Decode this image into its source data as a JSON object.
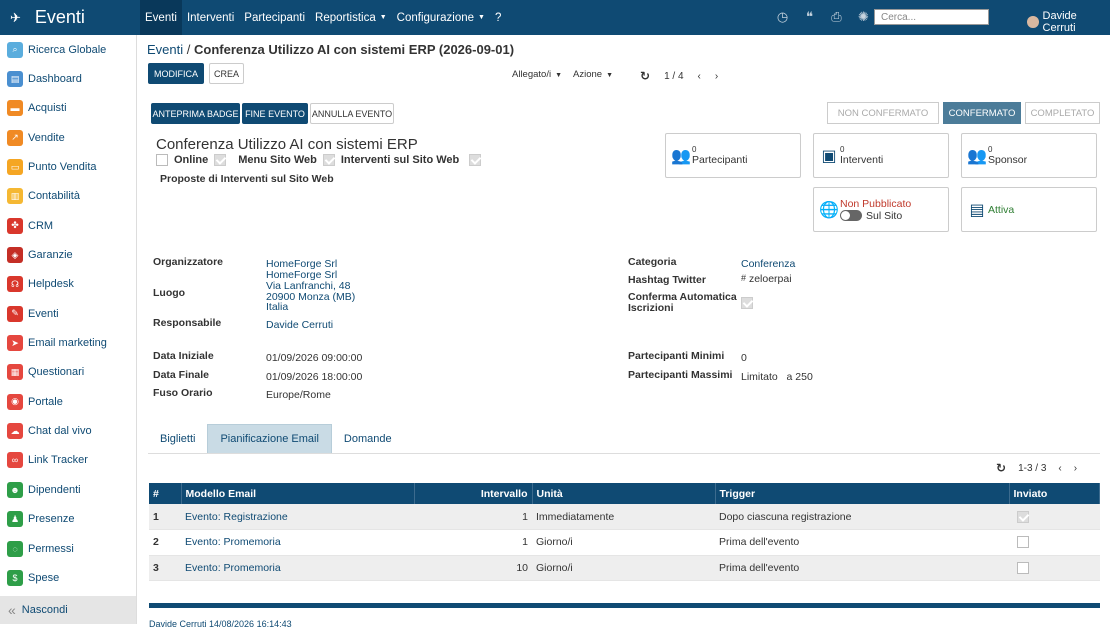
{
  "app": {
    "title": "Eventi"
  },
  "menu": {
    "items": [
      "Eventi",
      "Interventi",
      "Partecipanti",
      "Reportistica",
      "Configurazione",
      "?"
    ]
  },
  "search": {
    "placeholder": "Cerca..."
  },
  "user": {
    "name": "Davide Cerruti"
  },
  "sidebar": {
    "items": [
      {
        "label": "Ricerca Globale",
        "color": "#5aaddd",
        "glyph": "⌕"
      },
      {
        "label": "Dashboard",
        "color": "#4a8fd0",
        "glyph": "▤"
      },
      {
        "label": "Acquisti",
        "color": "#f08a24",
        "glyph": "▬"
      },
      {
        "label": "Vendite",
        "color": "#f08a24",
        "glyph": "↗"
      },
      {
        "label": "Punto Vendita",
        "color": "#f5a623",
        "glyph": "▭"
      },
      {
        "label": "Contabilità",
        "color": "#f5b833",
        "glyph": "▥"
      },
      {
        "label": "CRM",
        "color": "#d9372c",
        "glyph": "✤"
      },
      {
        "label": "Garanzie",
        "color": "#c42e26",
        "glyph": "◈"
      },
      {
        "label": "Helpdesk",
        "color": "#d9372c",
        "glyph": "☊"
      },
      {
        "label": "Eventi",
        "color": "#d9372c",
        "glyph": "✎"
      },
      {
        "label": "Email marketing",
        "color": "#e5473f",
        "glyph": "➤"
      },
      {
        "label": "Questionari",
        "color": "#e5473f",
        "glyph": "▦"
      },
      {
        "label": "Portale",
        "color": "#e5473f",
        "glyph": "◉"
      },
      {
        "label": "Chat dal vivo",
        "color": "#e5473f",
        "glyph": "☁"
      },
      {
        "label": "Link Tracker",
        "color": "#e5473f",
        "glyph": "∞"
      },
      {
        "label": "Dipendenti",
        "color": "#2e9e48",
        "glyph": "☻"
      },
      {
        "label": "Presenze",
        "color": "#2e9e48",
        "glyph": "♟"
      },
      {
        "label": "Permessi",
        "color": "#2e9e48",
        "glyph": "◌"
      },
      {
        "label": "Spese",
        "color": "#2e9e48",
        "glyph": "$"
      }
    ],
    "hide": "Nascondi"
  },
  "breadcrumb": {
    "parent": "Eventi",
    "current": "Conferenza Utilizzo AI con sistemi ERP (2026-09-01)"
  },
  "actions": {
    "edit": "MODIFICA",
    "create": "CREA",
    "attachment": "Allegato/i",
    "action": "Azione",
    "pager": "1 / 4"
  },
  "buttons": {
    "badge": "ANTEPRIMA BADGE",
    "end": "FINE EVENTO",
    "cancel": "ANNULLA EVENTO"
  },
  "status": {
    "stages": [
      "NON CONFERMATO",
      "CONFERMATO",
      "COMPLETATO"
    ],
    "current": "CONFERMATO"
  },
  "record": {
    "name": "Conferenza Utilizzo AI con sistemi ERP",
    "flags": [
      {
        "label": "Online",
        "checked": false
      },
      {
        "label": "Menu Sito Web",
        "checked": true
      },
      {
        "label": "Interventi sul Sito Web",
        "checked": true
      }
    ],
    "proposte": "Proposte di Interventi sul Sito Web"
  },
  "smart": {
    "partecipanti": {
      "count": "0",
      "label": "Partecipanti"
    },
    "interventi": {
      "count": "0",
      "label": "Interventi"
    },
    "sponsor": {
      "count": "0",
      "label": "Sponsor"
    },
    "publish": {
      "state": "Non Pubblicato",
      "label": "Sul Sito"
    },
    "active": {
      "label": "Attiva"
    }
  },
  "fields": {
    "organizzatore_label": "Organizzatore",
    "organizzatore": "HomeForge Srl",
    "luogo_label": "Luogo",
    "luogo": [
      "HomeForge Srl",
      "Via Lanfranchi, 48",
      "20900 Monza (MB)",
      "Italia"
    ],
    "responsabile_label": "Responsabile",
    "responsabile": "Davide Cerruti",
    "data_iniziale_label": "Data Iniziale",
    "data_iniziale": "01/09/2026 09:00:00",
    "data_finale_label": "Data Finale",
    "data_finale": "01/09/2026 18:00:00",
    "fuso_label": "Fuso Orario",
    "fuso": "Europe/Rome",
    "categoria_label": "Categoria",
    "categoria": "Conferenza",
    "hashtag_label": "Hashtag Twitter",
    "hashtag_prefix": "#",
    "hashtag": "zeloerpai",
    "conferma_label": "Conferma Automatica Iscrizioni",
    "min_label": "Partecipanti Minimi",
    "min": "0",
    "max_label": "Partecipanti Massimi",
    "max_mode": "Limitato",
    "max_prefix": "a",
    "max": "250"
  },
  "tabs": [
    "Biglietti",
    "Pianificazione Email",
    "Domande"
  ],
  "table": {
    "pager": "1-3 / 3",
    "headers": [
      "#",
      "Modello Email",
      "Intervallo",
      "Unità",
      "Trigger",
      "Inviato"
    ],
    "rows": [
      {
        "n": "1",
        "modello": "Evento: Registrazione",
        "intervallo": "1",
        "unita": "Immediatamente",
        "trigger": "Dopo ciascuna registrazione",
        "inviato": true
      },
      {
        "n": "2",
        "modello": "Evento: Promemoria",
        "intervallo": "1",
        "unita": "Giorno/i",
        "trigger": "Prima dell'evento",
        "inviato": false
      },
      {
        "n": "3",
        "modello": "Evento: Promemoria",
        "intervallo": "10",
        "unita": "Giorno/i",
        "trigger": "Prima dell'evento",
        "inviato": false
      }
    ]
  },
  "footer": "Davide Cerruti 14/08/2026 16:14:43"
}
